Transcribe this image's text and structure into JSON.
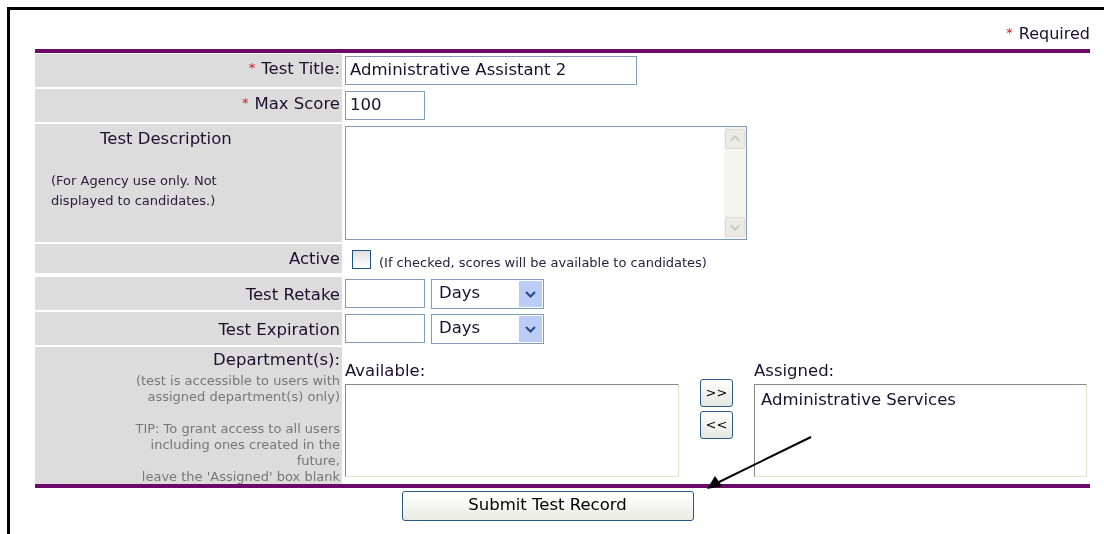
{
  "required_note": {
    "mark": "*",
    "text": "Required"
  },
  "fields": [
    {
      "kind": "text",
      "required_mark": "*",
      "label": "Test Title:",
      "value": "Administrative Assistant 2"
    },
    {
      "kind": "number",
      "required_mark": "*",
      "label": "Max Score",
      "value": "100"
    },
    {
      "kind": "textarea",
      "label": "Test Description",
      "note_lines": [
        "(For Agency use only. Not",
        "displayed to candidates.)"
      ]
    },
    {
      "kind": "checkbox",
      "label": "Active",
      "checked": false,
      "hint": "(If checked, scores will be available to candidates)"
    },
    {
      "kind": "duration",
      "label": "Test Retake",
      "unit": "Days"
    },
    {
      "kind": "duration",
      "label": "Test Expiration",
      "unit": "Days"
    },
    {
      "kind": "departments",
      "label": "Department(s):",
      "note_lines": [
        "(test is accessible to users with",
        "assigned department(s) only)"
      ],
      "tip_lines": [
        "TIP: To grant access to all users",
        "including ones created in the",
        "future,",
        "leave the 'Assigned' box blank"
      ],
      "available_label": "Available:",
      "add_button": ">>",
      "remove_button": "<<",
      "assigned_label": "Assigned:",
      "assigned": [
        "Administrative Services"
      ]
    }
  ],
  "submit_button": "Submit Test Record"
}
